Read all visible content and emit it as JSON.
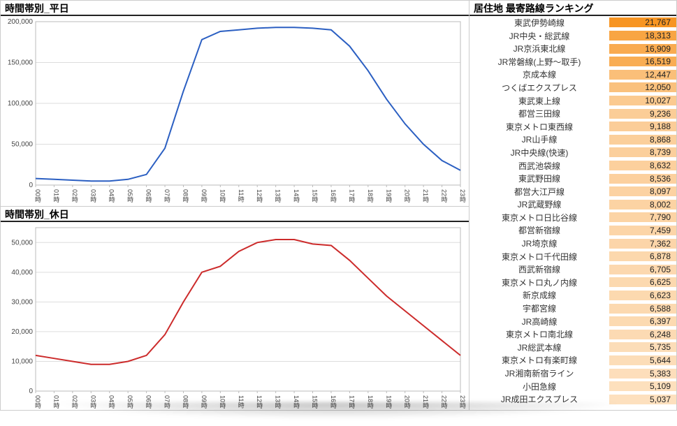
{
  "charts": {
    "weekday": {
      "title": "時間帯別_平日",
      "line_color": "#2b5fc2"
    },
    "holiday": {
      "title": "時間帯別_休日",
      "line_color": "#cc2b2b"
    }
  },
  "ranking": {
    "title": "居住地 最寄路線ランキング",
    "bar_start": "#f7931e",
    "bar_end": "#ffffff"
  },
  "chart_data": [
    {
      "id": "weekday",
      "type": "line",
      "title": "時間帯別_平日",
      "xlabel": "",
      "ylabel": "",
      "ylim": [
        0,
        200000
      ],
      "yticks": [
        0,
        50000,
        100000,
        150000,
        200000
      ],
      "categories": [
        "00時",
        "01時",
        "02時",
        "03時",
        "04時",
        "05時",
        "06時",
        "07時",
        "08時",
        "09時",
        "10時",
        "11時",
        "12時",
        "13時",
        "14時",
        "15時",
        "16時",
        "17時",
        "18時",
        "19時",
        "20時",
        "21時",
        "22時",
        "23時"
      ],
      "series": [
        {
          "name": "weekday",
          "color": "#2b5fc2",
          "values": [
            8000,
            7000,
            6000,
            5000,
            5000,
            7000,
            13000,
            45000,
            115000,
            178000,
            188000,
            190000,
            192000,
            193000,
            193000,
            192000,
            190000,
            170000,
            140000,
            105000,
            75000,
            50000,
            30000,
            18000
          ]
        }
      ]
    },
    {
      "id": "holiday",
      "type": "line",
      "title": "時間帯別_休日",
      "xlabel": "",
      "ylabel": "",
      "ylim": [
        0,
        55000
      ],
      "yticks": [
        0,
        10000,
        20000,
        30000,
        40000,
        50000
      ],
      "categories": [
        "00時",
        "01時",
        "02時",
        "03時",
        "04時",
        "05時",
        "06時",
        "07時",
        "08時",
        "09時",
        "10時",
        "11時",
        "12時",
        "13時",
        "14時",
        "15時",
        "16時",
        "17時",
        "18時",
        "19時",
        "20時",
        "21時",
        "22時",
        "23時"
      ],
      "series": [
        {
          "name": "holiday",
          "color": "#cc2b2b",
          "values": [
            12000,
            11000,
            10000,
            9000,
            9000,
            10000,
            12000,
            19000,
            30000,
            40000,
            42000,
            47000,
            50000,
            51000,
            51000,
            49500,
            49000,
            44000,
            38000,
            32000,
            27000,
            22000,
            17000,
            12000
          ]
        }
      ]
    },
    {
      "id": "ranking",
      "type": "bar",
      "title": "居住地 最寄路線ランキング",
      "xlabel": "",
      "ylabel": "",
      "categories": [
        "東武伊勢崎線",
        "JR中央・総武線",
        "JR京浜東北線",
        "JR常磐線(上野～取手)",
        "京成本線",
        "つくばエクスプレス",
        "東武東上線",
        "都営三田線",
        "東京メトロ東西線",
        "JR山手線",
        "JR中央線(快速)",
        "西武池袋線",
        "東武野田線",
        "都営大江戸線",
        "JR武蔵野線",
        "東京メトロ日比谷線",
        "都営新宿線",
        "JR埼京線",
        "東京メトロ千代田線",
        "西武新宿線",
        "東京メトロ丸ノ内線",
        "新京成線",
        "宇都宮線",
        "JR高崎線",
        "東京メトロ南北線",
        "JR総武本線",
        "東京メトロ有楽町線",
        "JR湘南新宿ライン",
        "小田急線",
        "JR成田エクスプレス"
      ],
      "values": [
        21767,
        18313,
        16909,
        16519,
        12447,
        12050,
        10027,
        9236,
        9188,
        8868,
        8739,
        8632,
        8536,
        8097,
        8002,
        7790,
        7459,
        7362,
        6878,
        6705,
        6625,
        6623,
        6588,
        6397,
        6248,
        5735,
        5644,
        5383,
        5109,
        5037
      ]
    }
  ]
}
